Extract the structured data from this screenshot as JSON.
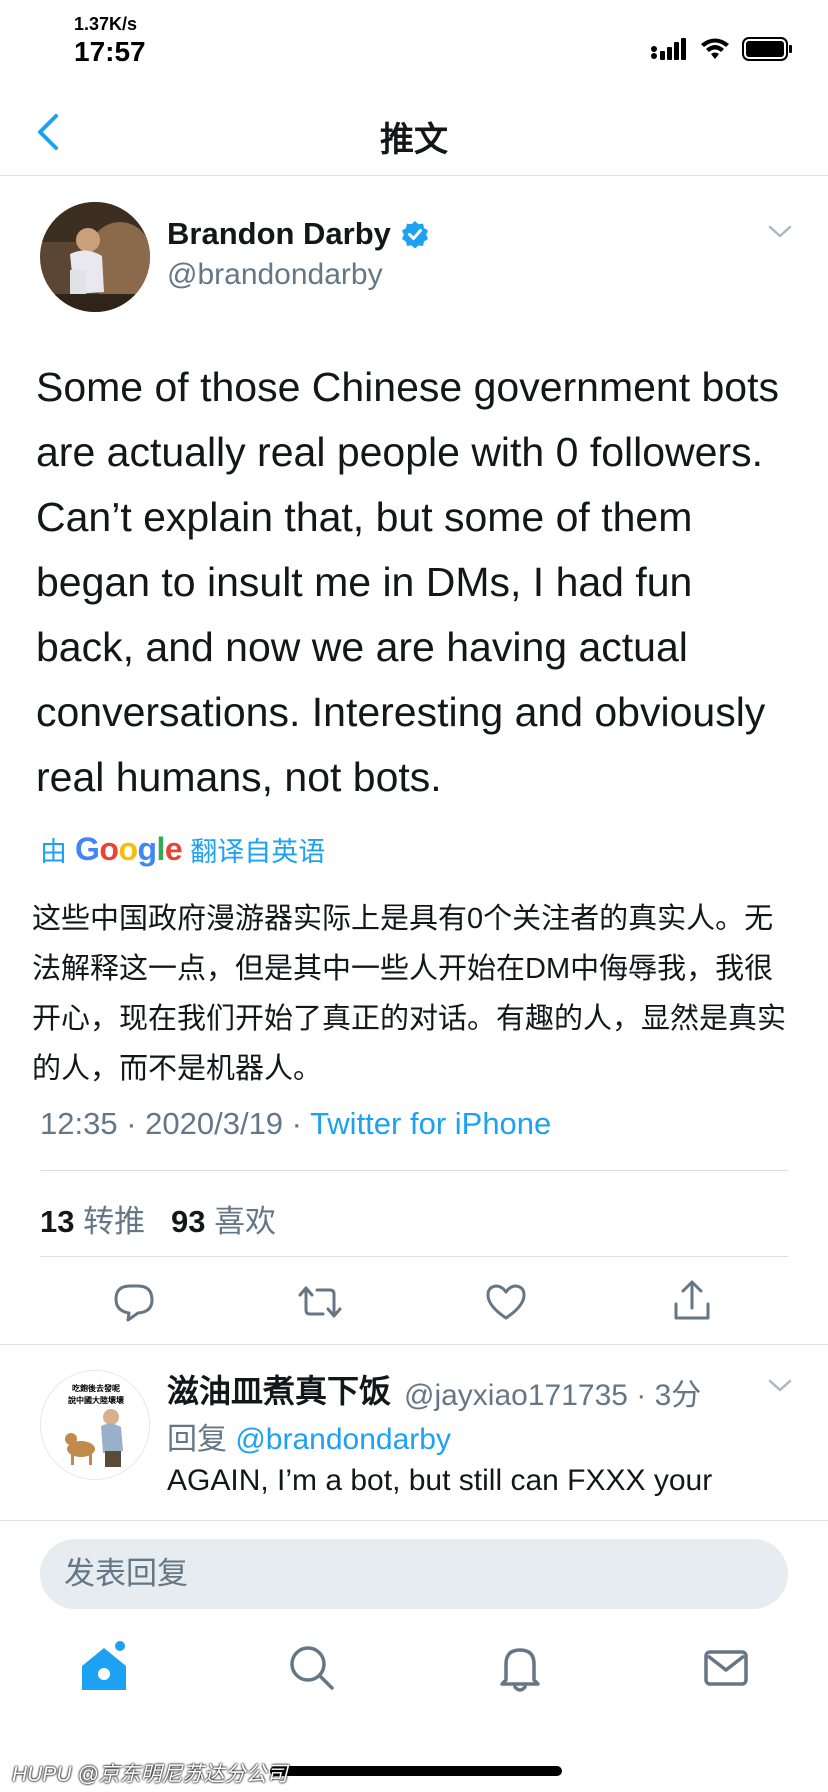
{
  "status_bar": {
    "net_speed": "1.37K/s",
    "time": "17:57"
  },
  "nav": {
    "title": "推文",
    "back_icon": "chevron-left-icon"
  },
  "tweet": {
    "author_name": "Brandon Darby",
    "verified": true,
    "handle": "@brandondarby",
    "text": "Some of those Chinese government bots are actually real people with 0 followers. Can’t explain that, but some of them began to insult me in DMs, I had fun back, and now we are having actual conversations. Interesting and obviously real humans, not bots.",
    "translate_prefix": "由",
    "translate_brand": "Google",
    "translate_suffix": "翻译自英语",
    "translated_text": "这些中国政府漫游器实际上是具有0个关注者的真实人。无法解释这一点，但是其中一些人开始在DM中侮辱我，我很开心，现在我们开始了真正的对话。有趣的人，显然是真实的人，而不是机器人。",
    "time": "12:35",
    "sep": " · ",
    "date": "2020/3/19",
    "source": "Twitter for iPhone",
    "retweets": "13",
    "retweets_label": "转推",
    "likes": "93",
    "likes_label": "喜欢"
  },
  "reply": {
    "name": "滋油皿煮真下饭",
    "handle_time": "@jayxiao171735 · 3分",
    "reply_prefix": "回复",
    "reply_mention": "@brandondarby",
    "text": "AGAIN, I’m a bot, but still can FXXX your",
    "avatar_text_1": "吃飽後去發呢",
    "avatar_text_2": "說中國大陸壞壞"
  },
  "compose": {
    "placeholder": "发表回复"
  },
  "tabs": [
    "home-icon",
    "search-icon",
    "notifications-icon",
    "messages-icon"
  ],
  "watermark": "HUPU @京东明尼苏达分公司",
  "colors": {
    "accent": "#1da1f2",
    "secondary_text": "#657786",
    "primary_text": "#14171a",
    "divider": "#dcdfe3",
    "compose_bg": "#e6ecf0"
  }
}
